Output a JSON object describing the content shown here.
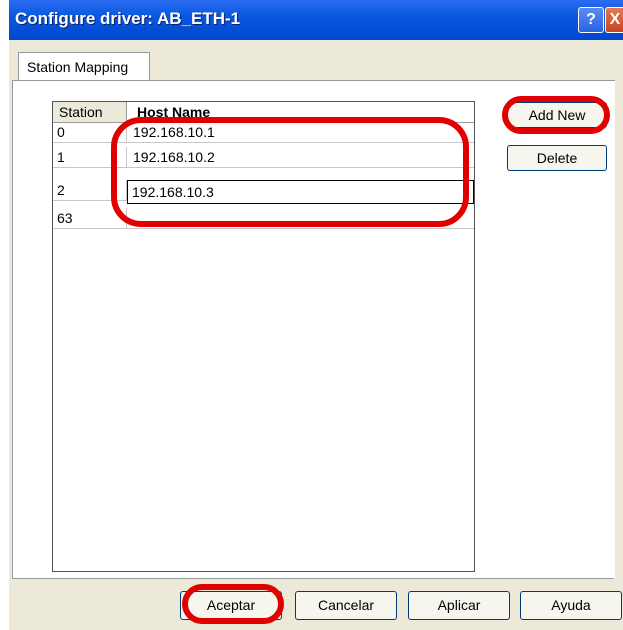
{
  "window": {
    "title": "Configure driver: AB_ETH-1"
  },
  "titlebar": {
    "help_glyph": "?",
    "close_glyph": "X"
  },
  "tabs": [
    {
      "label": "Station Mapping"
    }
  ],
  "grid": {
    "columns": [
      "Station",
      "Host Name"
    ],
    "rows": [
      {
        "station": "0",
        "host": "192.168.10.1"
      },
      {
        "station": "1",
        "host": "192.168.10.2"
      },
      {
        "station": "2",
        "host": "192.168.10.3"
      },
      {
        "station": "63",
        "host": ""
      }
    ]
  },
  "side_buttons": {
    "add_new": "Add New",
    "delete": "Delete"
  },
  "footer_buttons": {
    "ok": "Aceptar",
    "cancel": "Cancelar",
    "apply": "Aplicar",
    "help": "Ayuda"
  },
  "colors": {
    "title_bar": "#0a58e0",
    "highlight": "#e00000",
    "dialog": "#ece9d8"
  },
  "icons": {
    "help": "help-question-icon",
    "close": "close-x-icon"
  }
}
